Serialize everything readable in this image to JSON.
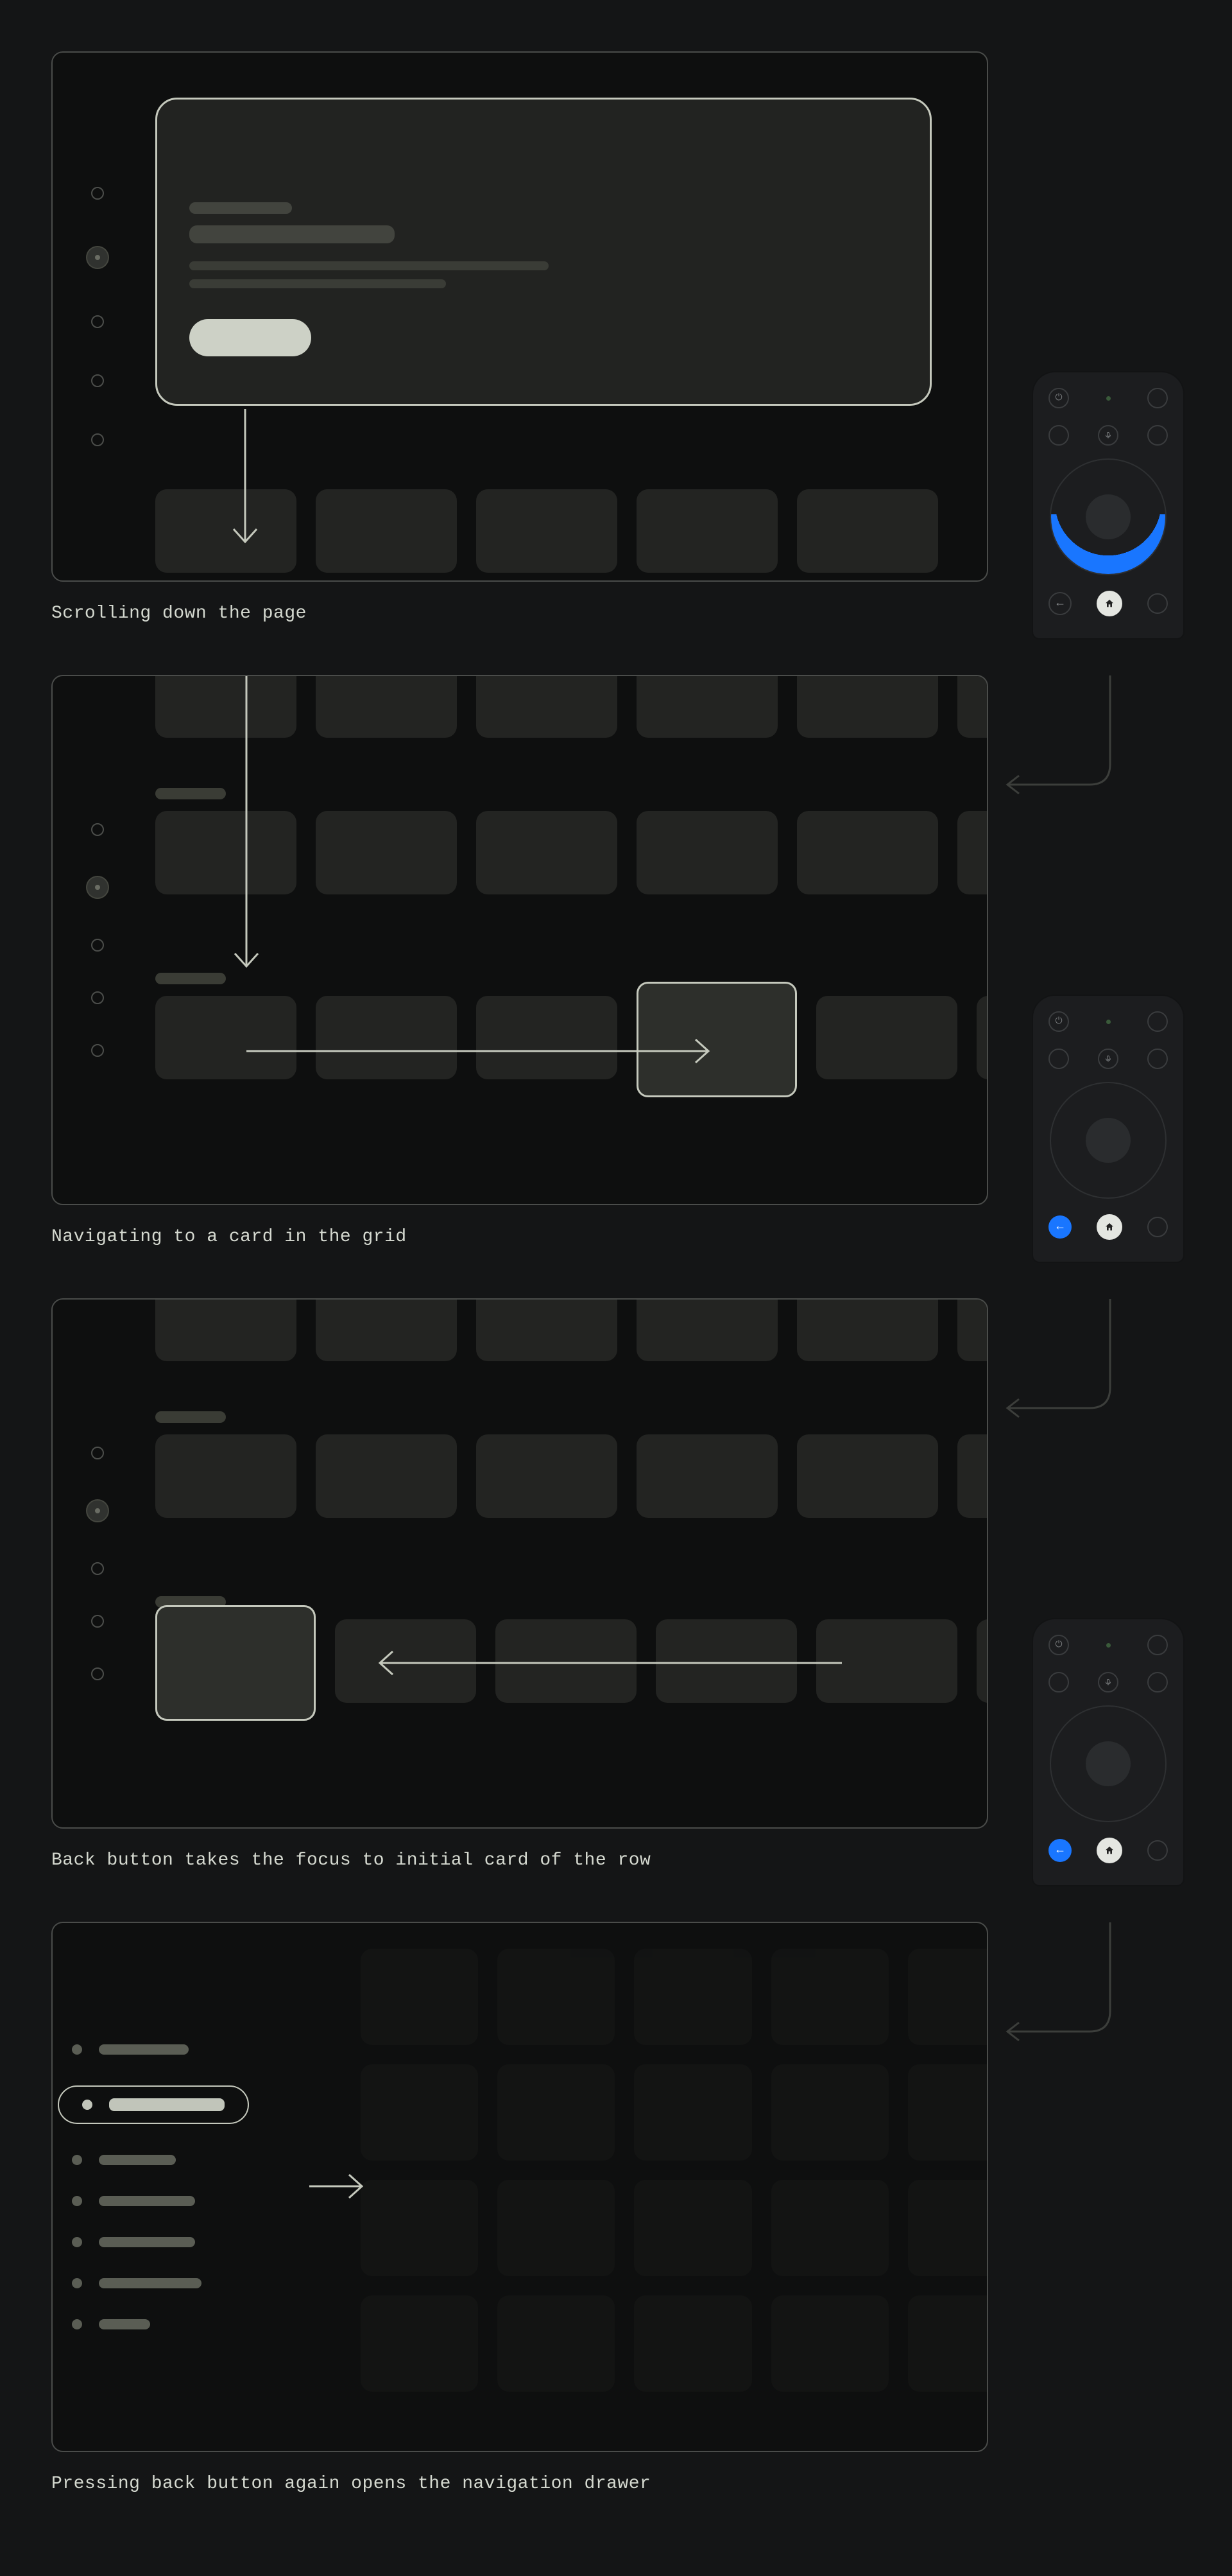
{
  "captions": {
    "p1": "Scrolling down the page",
    "p2": "Navigating to a card in the grid",
    "p3": "Back button takes the focus to initial card of the row",
    "p4": "Pressing back button again opens the navigation drawer"
  },
  "remote": {
    "power_icon": "⏻",
    "mic_icon": "🎤",
    "back_icon": "←",
    "home_icon": "⮕"
  },
  "diagram": {
    "panels": 4,
    "remote_states": [
      {
        "dpad_down_highlight": true,
        "back_highlight": false
      },
      {
        "dpad_down_highlight": false,
        "back_highlight": true
      },
      {
        "dpad_down_highlight": false,
        "back_highlight": true
      }
    ],
    "nav_drawer_items": 7,
    "nav_drawer_active_index": 1
  }
}
